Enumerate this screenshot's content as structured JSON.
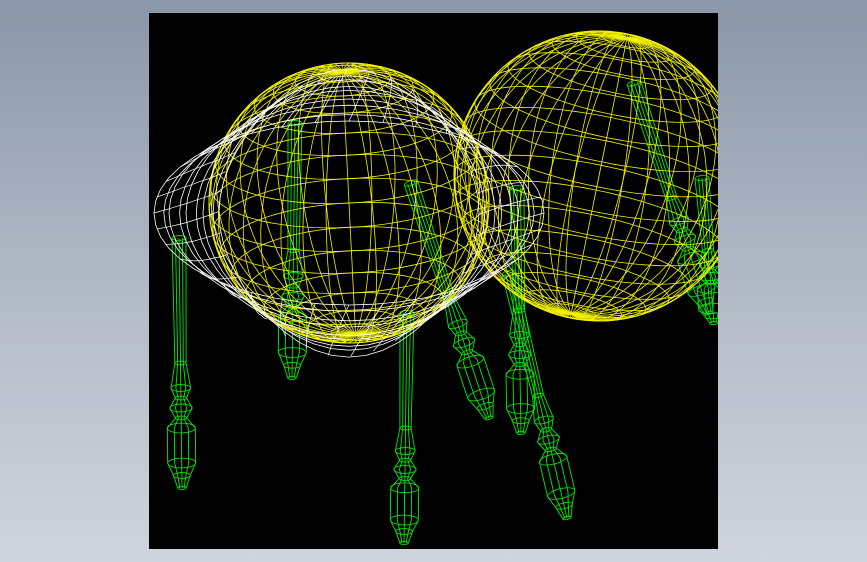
{
  "viewport": {
    "background": "#000000",
    "page_background": "#a7b0bd",
    "colors": {
      "yellow_wire": "#f2f200",
      "white_wire": "#ffffff",
      "green_wire": "#00ee00"
    },
    "content": "wireframe-3d-model",
    "parts": [
      {
        "name": "yellow-sphere-left",
        "color": "#f2f200"
      },
      {
        "name": "yellow-sphere-right",
        "color": "#f2f200"
      },
      {
        "name": "white-torus-ring",
        "color": "#ffffff"
      },
      {
        "name": "green-legs",
        "color": "#00ee00"
      }
    ]
  }
}
